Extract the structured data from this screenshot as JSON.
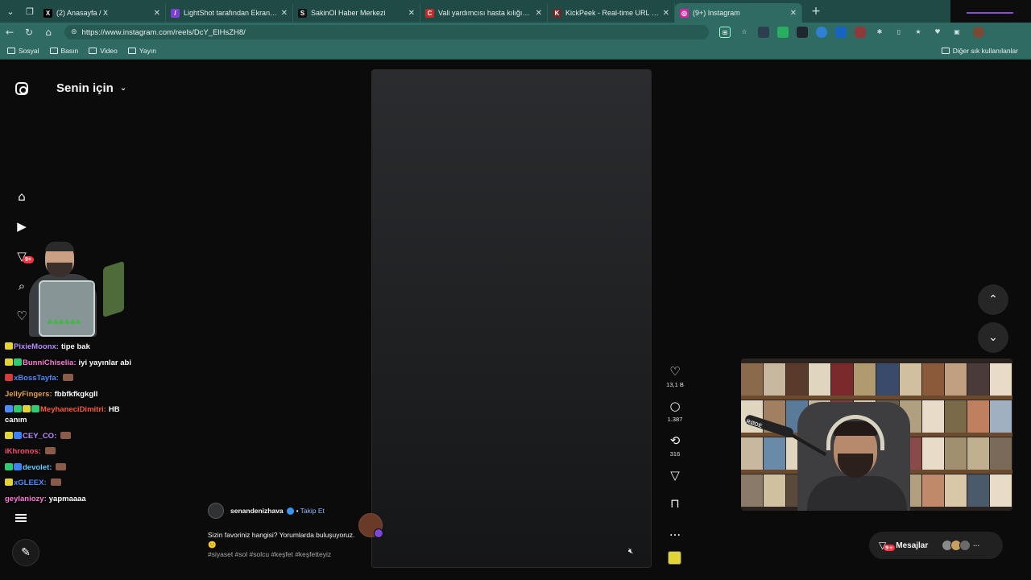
{
  "browser": {
    "tabs": [
      {
        "title": "(2) Anasayfa / X",
        "fav": "X",
        "favColor": "#000000",
        "active": false
      },
      {
        "title": "LightShot tarafından Ekran Görüntüsü",
        "fav": "/",
        "favColor": "#7b3fd6",
        "active": false
      },
      {
        "title": "SakinOl Haber Merkezi",
        "fav": "S",
        "favColor": "#111111",
        "active": false
      },
      {
        "title": "Vali yardımcısı hasta kılığında acile",
        "fav": "C",
        "favColor": "#c62828",
        "active": false
      },
      {
        "title": "KickPeek - Real-time URL Crawler",
        "fav": "K",
        "favColor": "#6b2a2a",
        "active": false
      },
      {
        "title": "(9+) Instagram",
        "fav": "◎",
        "favColor": "#d6249f",
        "active": true
      }
    ],
    "url": "https://www.instagram.com/reels/DcY_ElHsZH8/",
    "bookmarks": [
      "Sosyal",
      "Basın",
      "Video",
      "Yayın"
    ],
    "bookmarks_right": "Diğer sık kullanılanlar"
  },
  "page": {
    "feed_title": "Senin için",
    "notification_badge": "9+",
    "chat": [
      {
        "user": "PixieMoonx:",
        "color": "#b98cff",
        "text": "tipe bak",
        "icons": [
          "#e2d339"
        ]
      },
      {
        "user": "BunniChiselia:",
        "color": "#ff7ad9",
        "text": "iyi yayınlar abi",
        "icons": [
          "#e2d339",
          "#2ecc71"
        ]
      },
      {
        "user": "xBossTayfa:",
        "color": "#4d8cff",
        "text": "",
        "icons": [
          "#d43b3b"
        ],
        "emote": true
      },
      {
        "user": "JellyFingers:",
        "color": "#e6a23c",
        "text": "fbbfkfkgkgll",
        "icons": []
      },
      {
        "user": "MeyhaneciDimitri:",
        "color": "#ff5a36",
        "text": "HB canım",
        "icons": [
          "#4d8cff",
          "#2ecc71",
          "#e2d339",
          "#2ecc71"
        ]
      },
      {
        "user": "CEY_CO:",
        "color": "#b98cff",
        "text": "",
        "icons": [
          "#e2d339",
          "#3b82f6"
        ],
        "emote": true
      },
      {
        "user": "iKhronos:",
        "color": "#ff4d6d",
        "text": "",
        "icons": [],
        "emote": true
      },
      {
        "user": "devolet:",
        "color": "#5ad1ff",
        "text": "",
        "icons": [
          "#2ecc71",
          "#3b82f6"
        ],
        "emote": true
      },
      {
        "user": "xGLEEX:",
        "color": "#4d8cff",
        "text": "",
        "icons": [
          "#e2d339"
        ],
        "emote": true
      },
      {
        "user": "geylaniozy:",
        "color": "#ff7ad9",
        "text": "yapmaaaa",
        "icons": []
      }
    ],
    "reel": {
      "author": "senandenizhava",
      "follow_label": "Takip Et",
      "caption": "Sizin favoriniz hangisi? Yorumlarda buluşuyoruz.🙂",
      "tags": "#siyaset #sol #solcu #keşfet #keşfetteyiz",
      "likes": "13,1 B",
      "comments": "1.387",
      "reposts": "316",
      "more": "..."
    },
    "messages_label": "Mesajlar",
    "messages_badge": "9+"
  }
}
